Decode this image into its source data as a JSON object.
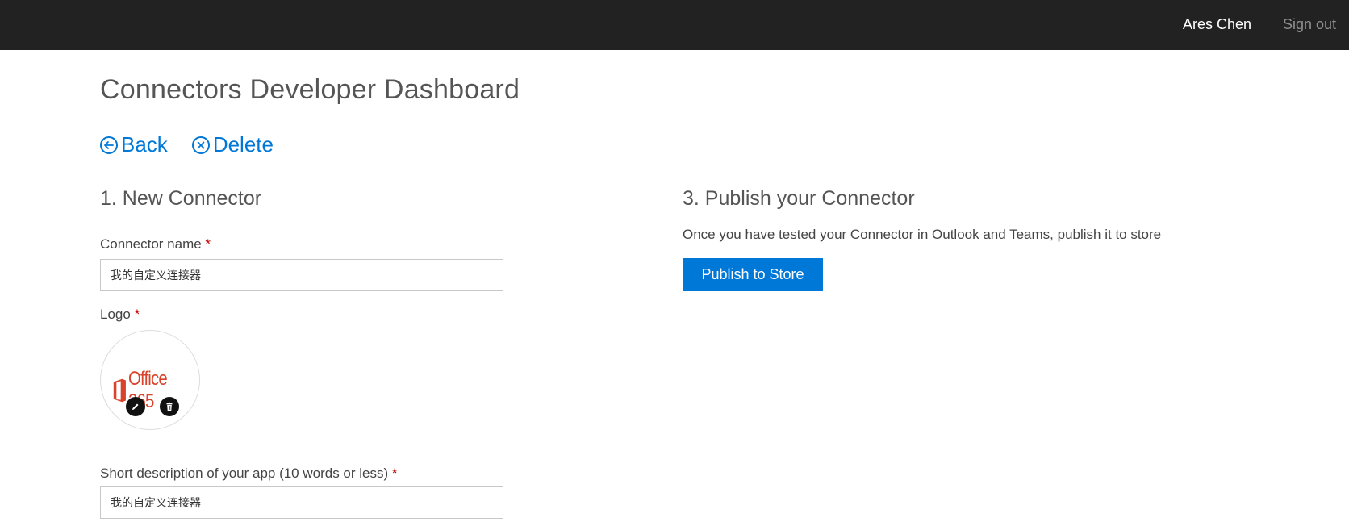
{
  "header": {
    "user_name": "Ares Chen",
    "sign_out_label": "Sign out"
  },
  "page": {
    "title": "Connectors Developer Dashboard"
  },
  "actions": {
    "back_label": "Back",
    "delete_label": "Delete"
  },
  "new_connector": {
    "section_title": "1. New Connector",
    "name_label": "Connector name",
    "name_value": "我的自定义连接器",
    "logo_label": "Logo",
    "logo_text": "Office 365",
    "short_desc_label": "Short description of your app (10 words or less)",
    "short_desc_value": "我的自定义连接器",
    "required_marker": "*"
  },
  "publish": {
    "section_title": "3. Publish your Connector",
    "description": "Once you have tested your Connector in Outlook and Teams, publish it to store",
    "button_label": "Publish to Store"
  },
  "colors": {
    "topbar": "#222222",
    "accent": "#0078d7",
    "required": "#c00000",
    "logo": "#d9432c"
  },
  "icons": {
    "back": "arrow-left-circle-icon",
    "delete": "x-circle-icon",
    "edit": "pencil-icon",
    "remove": "trash-icon"
  }
}
